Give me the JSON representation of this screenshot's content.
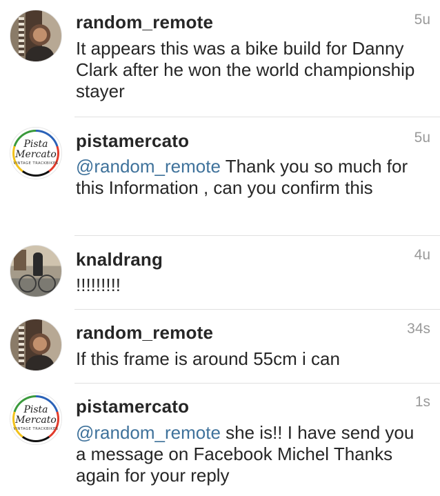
{
  "comments": [
    {
      "username": "random_remote",
      "time": "5u",
      "text": "It appears this was a bike build for Danny Clark after he won the world championship stayer",
      "avatar": "photo-man"
    },
    {
      "username": "pistamercato",
      "time": "5u",
      "mention": "@random_remote",
      "text": " Thank you so much for this Information , can you confirm this",
      "avatar": "logo",
      "logo_line1": "Pista",
      "logo_line2": "Mercato",
      "logo_tagline": "VINTAGE TRACKBIKES"
    },
    {
      "username": "knaldrang",
      "time": "4u",
      "text": "!!!!!!!!!",
      "avatar": "photo-bike"
    },
    {
      "username": "random_remote",
      "time": "34s",
      "text": "If this frame is around 55cm i can",
      "avatar": "photo-man"
    },
    {
      "username": "pistamercato",
      "time": "1s",
      "mention": "@random_remote",
      "text": " she is!! I have send you a message on Facebook Michel Thanks again for your reply",
      "avatar": "logo",
      "logo_line1": "Pista",
      "logo_line2": "Mercato",
      "logo_tagline": "VINTAGE TRACKBIKES"
    }
  ],
  "colors": {
    "text": "#262626",
    "mention": "#3f729b",
    "timestamp": "#999999",
    "divider": "#e0e0e0"
  }
}
